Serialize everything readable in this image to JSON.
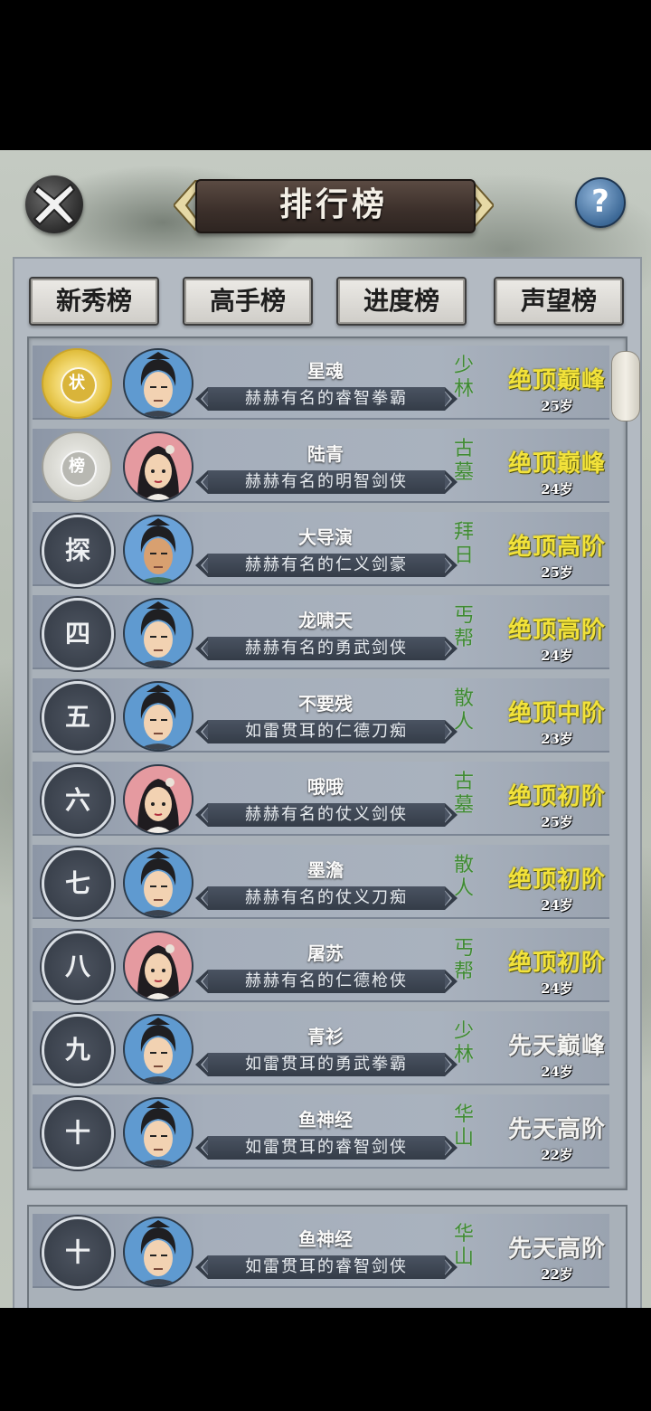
{
  "header": {
    "title": "排行榜",
    "help_label": "?"
  },
  "tabs": [
    "新秀榜",
    "高手榜",
    "进度榜",
    "声望榜"
  ],
  "colors": {
    "realm_gold": "#f2e23a",
    "realm_white": "#f4f4f2",
    "sect_green": "#3f8a34"
  },
  "rows": [
    {
      "rank": "状",
      "rank_style": "gold",
      "avatar": "male",
      "name": "星魂",
      "title": "赫赫有名的睿智拳霸",
      "sect": [
        "少",
        "林"
      ],
      "realm": "绝顶巅峰",
      "realm_color": "gold",
      "age": "25岁"
    },
    {
      "rank": "榜",
      "rank_style": "silver",
      "avatar": "female",
      "name": "陆青",
      "title": "赫赫有名的明智剑侠",
      "sect": [
        "古",
        "墓"
      ],
      "realm": "绝顶巅峰",
      "realm_color": "gold",
      "age": "24岁"
    },
    {
      "rank": "探",
      "rank_style": "dark",
      "avatar": "brown",
      "name": "大导演",
      "title": "赫赫有名的仁义剑豪",
      "sect": [
        "拜",
        "日"
      ],
      "realm": "绝顶高阶",
      "realm_color": "gold",
      "age": "25岁"
    },
    {
      "rank": "四",
      "rank_style": "dark",
      "avatar": "male",
      "name": "龙啸天",
      "title": "赫赫有名的勇武剑侠",
      "sect": [
        "丐",
        "帮"
      ],
      "realm": "绝顶高阶",
      "realm_color": "gold",
      "age": "24岁"
    },
    {
      "rank": "五",
      "rank_style": "dark",
      "avatar": "male",
      "name": "不要残",
      "title": "如雷贯耳的仁德刀痴",
      "sect": [
        "散",
        "人"
      ],
      "realm": "绝顶中阶",
      "realm_color": "gold",
      "age": "23岁"
    },
    {
      "rank": "六",
      "rank_style": "dark",
      "avatar": "female",
      "name": "哦哦",
      "title": "赫赫有名的仗义剑侠",
      "sect": [
        "古",
        "墓"
      ],
      "realm": "绝顶初阶",
      "realm_color": "gold",
      "age": "25岁"
    },
    {
      "rank": "七",
      "rank_style": "dark",
      "avatar": "male",
      "name": "墨澹",
      "title": "赫赫有名的仗义刀痴",
      "sect": [
        "散",
        "人"
      ],
      "realm": "绝顶初阶",
      "realm_color": "gold",
      "age": "24岁"
    },
    {
      "rank": "八",
      "rank_style": "dark",
      "avatar": "female",
      "name": "屠苏",
      "title": "赫赫有名的仁德枪侠",
      "sect": [
        "丐",
        "帮"
      ],
      "realm": "绝顶初阶",
      "realm_color": "gold",
      "age": "24岁"
    },
    {
      "rank": "九",
      "rank_style": "dark",
      "avatar": "male",
      "name": "青衫",
      "title": "如雷贯耳的勇武拳霸",
      "sect": [
        "少",
        "林"
      ],
      "realm": "先天巅峰",
      "realm_color": "white",
      "age": "24岁"
    },
    {
      "rank": "十",
      "rank_style": "dark",
      "avatar": "male",
      "name": "鱼神经",
      "title": "如雷贯耳的睿智剑侠",
      "sect": [
        "华",
        "山"
      ],
      "realm": "先天高阶",
      "realm_color": "white",
      "age": "22岁"
    }
  ],
  "self_row": {
    "rank": "十",
    "rank_style": "dark",
    "avatar": "male",
    "name": "鱼神经",
    "title": "如雷贯耳的睿智剑侠",
    "sect": [
      "华",
      "山"
    ],
    "realm": "先天高阶",
    "realm_color": "white",
    "age": "22岁"
  }
}
